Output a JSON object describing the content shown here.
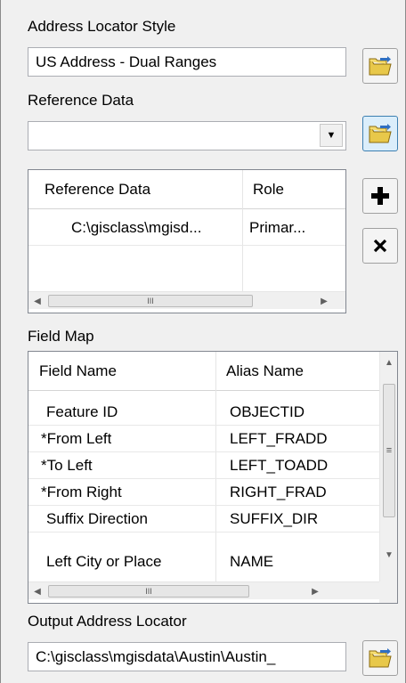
{
  "locator_style": {
    "label": "Address Locator Style",
    "value": "US Address - Dual Ranges"
  },
  "reference_data": {
    "label": "Reference Data",
    "value": ""
  },
  "reference_table": {
    "columns": [
      "Reference Data",
      "Role"
    ],
    "rows": [
      [
        "C:\\gisclass\\mgisd...",
        "Primar..."
      ]
    ],
    "scroll_grip": "III"
  },
  "field_map": {
    "label": "Field Map",
    "columns": [
      "Field Name",
      "Alias Name"
    ],
    "rows": [
      [
        "Feature ID",
        "OBJECTID"
      ],
      [
        "*From Left",
        "LEFT_FRADD"
      ],
      [
        "*To Left",
        "LEFT_TOADD"
      ],
      [
        "*From Right",
        "RIGHT_FRAD"
      ],
      [
        "Suffix Direction",
        "SUFFIX_DIR"
      ],
      [
        "Left City or Place",
        "NAME"
      ]
    ],
    "hscroll_grip": "III",
    "vscroll_grip": "≡"
  },
  "output": {
    "label": "Output Address Locator",
    "value": "C:\\gisclass\\mgisdata\\Austin\\Austin_"
  },
  "icons": {
    "add": "+",
    "remove": "✕",
    "combo_arrow": "▼",
    "left_arrow": "◀",
    "right_arrow": "▶",
    "up_arrow": "▲",
    "down_arrow": "▼"
  },
  "colors": {
    "folder_yellow": "#e8c84a",
    "folder_arrow": "#2f6fc1",
    "highlight_border": "#3c7fb1"
  }
}
